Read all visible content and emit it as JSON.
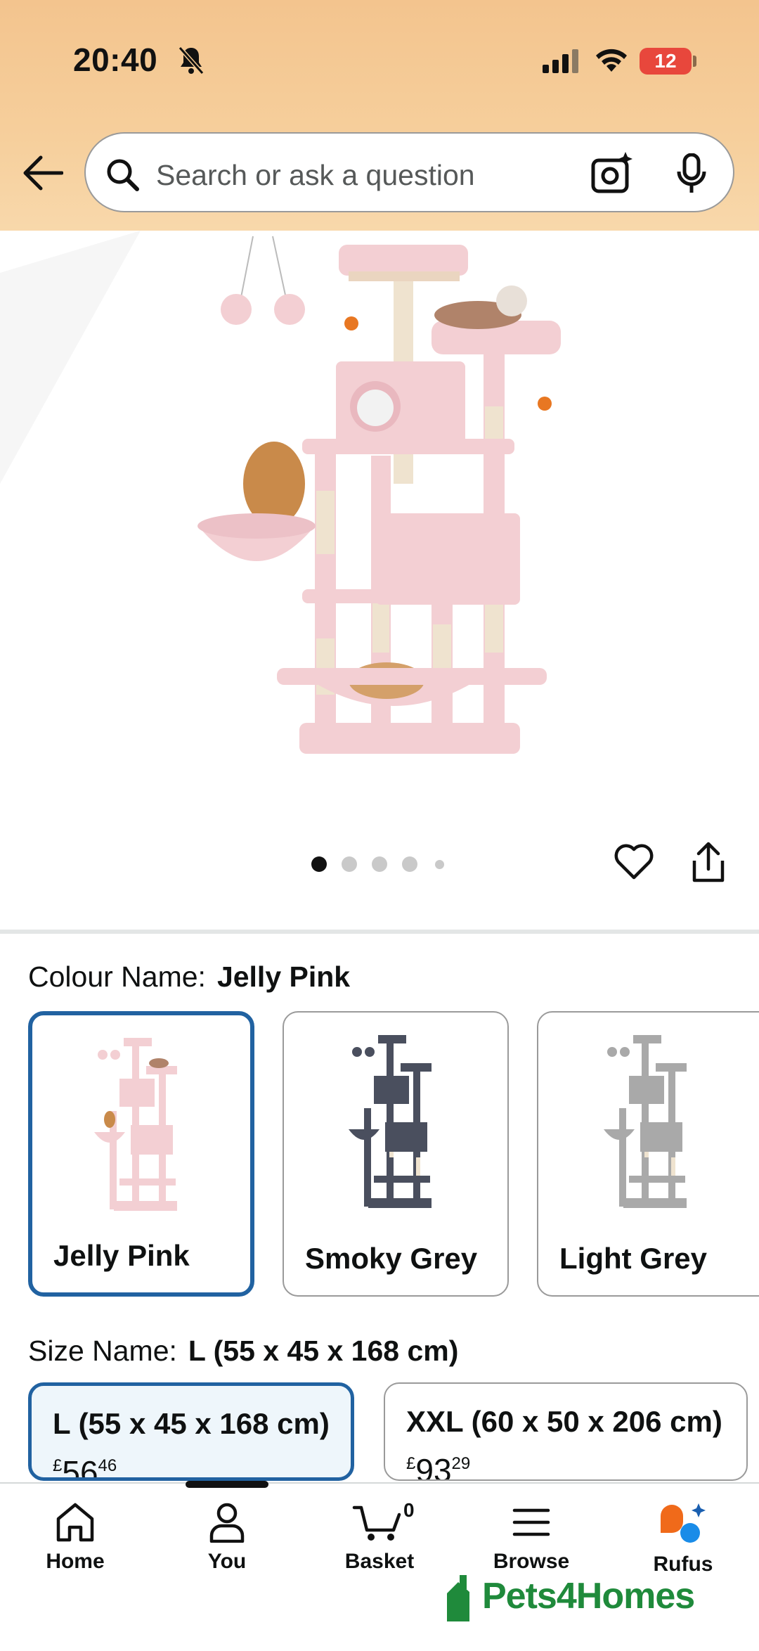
{
  "status_bar": {
    "time": "20:40",
    "battery": "12"
  },
  "search": {
    "placeholder": "Search or ask a question"
  },
  "gallery": {
    "image_count": 5,
    "active_index": 0
  },
  "colour": {
    "label": "Colour Name:",
    "selected": "Jelly Pink",
    "options": [
      {
        "name": "Jelly Pink",
        "color": "#f3cfd3"
      },
      {
        "name": "Smoky Grey",
        "color": "#4a4f5e"
      },
      {
        "name": "Light Grey",
        "color": "#a9a9a9"
      }
    ]
  },
  "size": {
    "label": "Size Name:",
    "selected": "L (55 x 45 x 168 cm)",
    "options": [
      {
        "name": "L (55 x 45 x 168 cm)",
        "currency": "£",
        "price_whole": "56",
        "price_fraction": "46"
      },
      {
        "name": "XXL (60 x 50 x 206 cm)",
        "currency": "£",
        "price_whole": "93",
        "price_fraction": "29"
      }
    ]
  },
  "nav": {
    "items": [
      {
        "label": "Home"
      },
      {
        "label": "You"
      },
      {
        "label": "Basket",
        "count": "0"
      },
      {
        "label": "Browse"
      },
      {
        "label": "Rufus"
      }
    ]
  },
  "watermark": "Pets4Homes",
  "colors": {
    "header": "#f3c48e",
    "selected_border": "#2162a1",
    "product_pink": "#f3cfd3"
  }
}
